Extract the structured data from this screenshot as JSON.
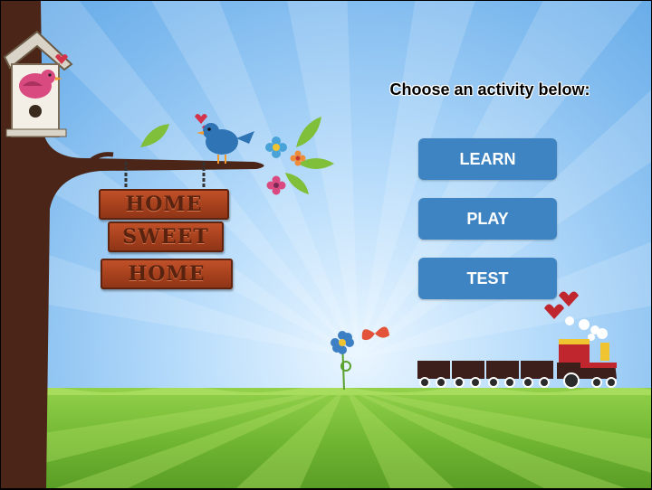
{
  "prompt": "Choose an activity below:",
  "buttons": {
    "learn": "LEARN",
    "play": "PLAY",
    "test": "TEST"
  },
  "sign": {
    "line1": "HOME",
    "line2": "SWEET",
    "line3": "HOME"
  },
  "colors": {
    "button": "#3f84c2",
    "sky": "#7db9ee",
    "grass": "#6fb531",
    "sign_wood": "#a23e1c",
    "tree_trunk": "#4a2518"
  },
  "icons": [
    "birdhouse-icon",
    "pink-bird-icon",
    "blue-bird-icon",
    "flower-icon",
    "butterfly-icon",
    "train-icon",
    "heart-icon",
    "leaf-icon"
  ]
}
